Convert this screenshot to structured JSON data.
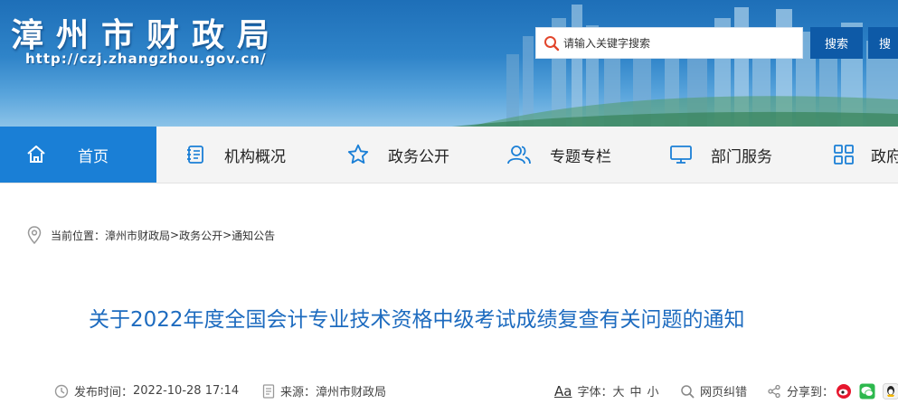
{
  "site": {
    "title": "漳州市财政局",
    "url": "http://czj.zhangzhou.gov.cn/"
  },
  "search": {
    "placeholder": "请输入关键字搜索",
    "button_label": "搜索",
    "second_button_label": "搜"
  },
  "nav": {
    "items": [
      {
        "label": "首页",
        "icon": "home-icon"
      },
      {
        "label": "机构概况",
        "icon": "document-list-icon"
      },
      {
        "label": "政务公开",
        "icon": "star-icon"
      },
      {
        "label": "专题专栏",
        "icon": "users-icon"
      },
      {
        "label": "部门服务",
        "icon": "monitor-icon"
      },
      {
        "label": "政府",
        "icon": "grid-icon"
      }
    ]
  },
  "breadcrumb": {
    "prefix": "当前位置：",
    "links": [
      "漳州市财政局",
      "政务公开",
      "通知公告"
    ],
    "separator": ">"
  },
  "article": {
    "title": "关于2022年度全国会计专业技术资格中级考试成绩复查有关问题的通知",
    "publish_label": "发布时间：",
    "publish_time": "2022-10-28 17:14",
    "source_label": "来源：",
    "source": "漳州市财政局",
    "font_icon_text": "Aa",
    "font_label": "字体：",
    "font_sizes": [
      "大",
      "中",
      "小"
    ],
    "correction_label": "网页纠错",
    "share_label": "分享到："
  },
  "colors": {
    "accent": "#1a7fd6",
    "title_blue": "#1d6bbf",
    "button_blue": "#0e5aa7"
  }
}
